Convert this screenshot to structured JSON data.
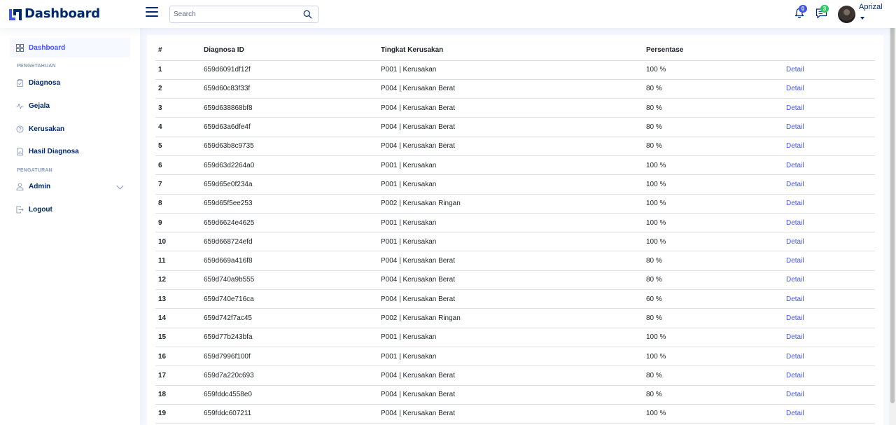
{
  "app": {
    "title": "Dashboard"
  },
  "header": {
    "search_placeholder": "Search",
    "notifications_count": "0",
    "messages_count": "3",
    "user_name": "Aprizal"
  },
  "sidebar": {
    "dashboard": "Dashboard",
    "section_pengetahuan": "PENGETAHUAN",
    "diagnosa": "Diagnosa",
    "gejala": "Gejala",
    "kerusakan": "Kerusakan",
    "hasil_diagnosa": "Hasil Diagnosa",
    "section_pengaturan": "PENGATURAN",
    "admin": "Admin",
    "logout": "Logout"
  },
  "table": {
    "headers": [
      "#",
      "Diagnosa ID",
      "Tingkat Kerusakan",
      "Persentase",
      ""
    ],
    "action_label": "Detail",
    "rows": [
      {
        "no": "1",
        "id": "659d6091df12f",
        "level": "P001 | Kerusakan",
        "pct": "100 %"
      },
      {
        "no": "2",
        "id": "659d60c83f33f",
        "level": "P004 | Kerusakan Berat",
        "pct": "80 %"
      },
      {
        "no": "3",
        "id": "659d638868bf8",
        "level": "P004 | Kerusakan Berat",
        "pct": "80 %"
      },
      {
        "no": "4",
        "id": "659d63a6dfe4f",
        "level": "P004 | Kerusakan Berat",
        "pct": "80 %"
      },
      {
        "no": "5",
        "id": "659d63b8c9735",
        "level": "P004 | Kerusakan Berat",
        "pct": "80 %"
      },
      {
        "no": "6",
        "id": "659d63d2264a0",
        "level": "P001 | Kerusakan",
        "pct": "100 %"
      },
      {
        "no": "7",
        "id": "659d65e0f234a",
        "level": "P001 | Kerusakan",
        "pct": "100 %"
      },
      {
        "no": "8",
        "id": "659d65f5ee253",
        "level": "P002 | Kerusakan Ringan",
        "pct": "100 %"
      },
      {
        "no": "9",
        "id": "659d6624e4625",
        "level": "P001 | Kerusakan",
        "pct": "100 %"
      },
      {
        "no": "10",
        "id": "659d668724efd",
        "level": "P001 | Kerusakan",
        "pct": "100 %"
      },
      {
        "no": "11",
        "id": "659d669a416f8",
        "level": "P004 | Kerusakan Berat",
        "pct": "80 %"
      },
      {
        "no": "12",
        "id": "659d740a9b555",
        "level": "P004 | Kerusakan Berat",
        "pct": "80 %"
      },
      {
        "no": "13",
        "id": "659d740e716ca",
        "level": "P004 | Kerusakan Berat",
        "pct": "60 %"
      },
      {
        "no": "14",
        "id": "659d742f7ac45",
        "level": "P002 | Kerusakan Ringan",
        "pct": "80 %"
      },
      {
        "no": "15",
        "id": "659d77b243bfa",
        "level": "P001 | Kerusakan",
        "pct": "100 %"
      },
      {
        "no": "16",
        "id": "659d7996f100f",
        "level": "P001 | Kerusakan",
        "pct": "100 %"
      },
      {
        "no": "17",
        "id": "659d7a220c693",
        "level": "P004 | Kerusakan Berat",
        "pct": "80 %"
      },
      {
        "no": "18",
        "id": "659fddc4558e0",
        "level": "P004 | Kerusakan Berat",
        "pct": "80 %"
      },
      {
        "no": "19",
        "id": "659fddc607211",
        "level": "P004 | Kerusakan Berat",
        "pct": "100 %"
      }
    ]
  },
  "colors": {
    "primary": "#012970",
    "accent": "#4154f1",
    "background": "#f6f9ff"
  }
}
